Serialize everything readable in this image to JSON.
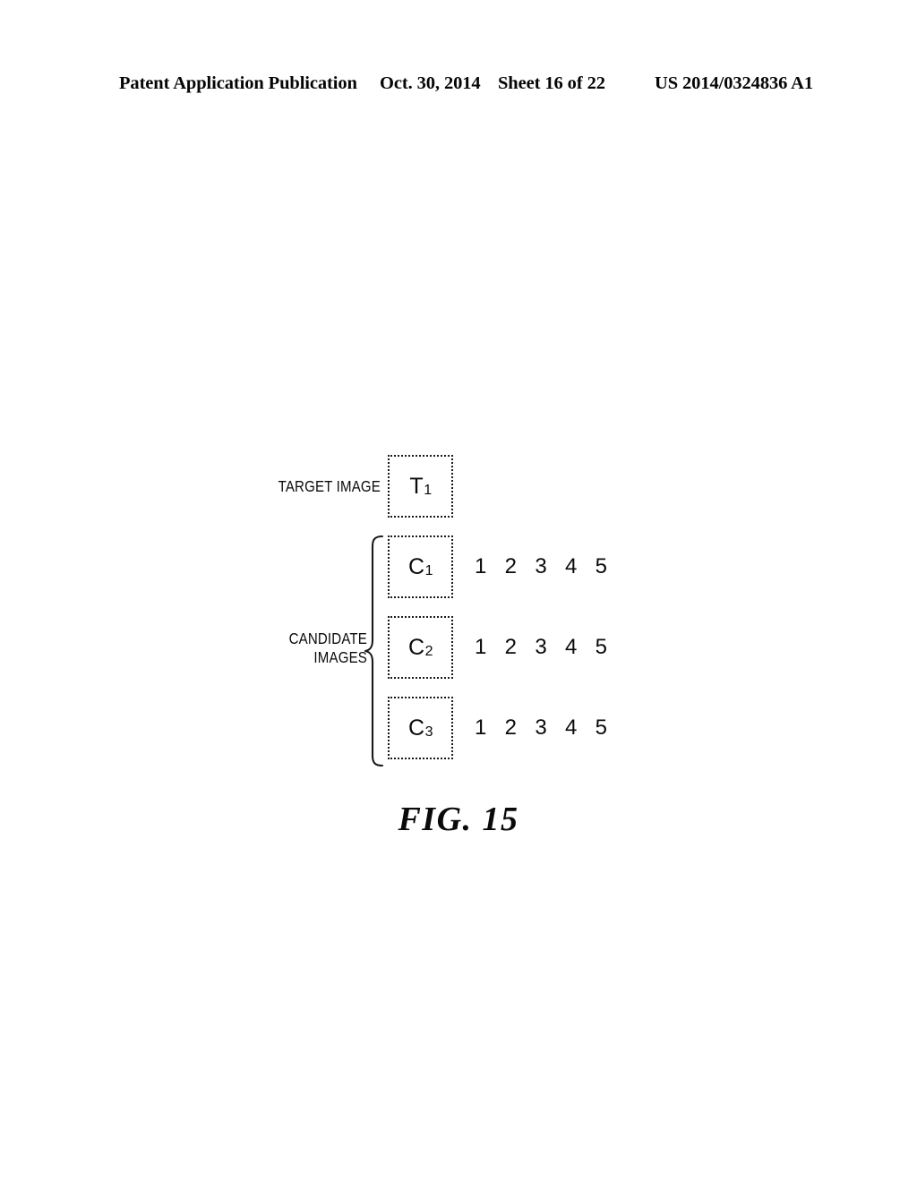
{
  "header": {
    "publication": "Patent Application Publication",
    "date": "Oct. 30, 2014",
    "sheet": "Sheet 16 of 22",
    "document_number": "US 2014/0324836 A1"
  },
  "figure": {
    "caption": "FIG. 15",
    "target_label": "TARGET IMAGE",
    "candidate_label": "CANDIDATE\nIMAGES",
    "boxes": [
      {
        "id": "target",
        "main": "T",
        "sub": "1"
      },
      {
        "id": "c1",
        "main": "C",
        "sub": "1"
      },
      {
        "id": "c2",
        "main": "C",
        "sub": "2"
      },
      {
        "id": "c3",
        "main": "C",
        "sub": "3"
      }
    ],
    "number_rows": [
      {
        "row": "c1",
        "values": [
          "1",
          "2",
          "3",
          "4",
          "5"
        ]
      },
      {
        "row": "c2",
        "values": [
          "1",
          "2",
          "3",
          "4",
          "5"
        ]
      },
      {
        "row": "c3",
        "values": [
          "1",
          "2",
          "3",
          "4",
          "5"
        ]
      }
    ],
    "colors": {
      "ink": "#0a0a0a",
      "border": "#1a1a1a",
      "page": "#ffffff"
    }
  }
}
